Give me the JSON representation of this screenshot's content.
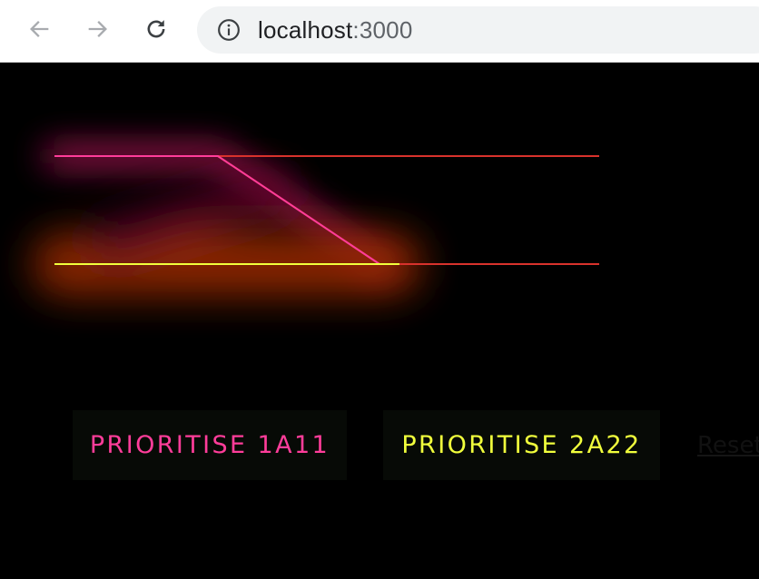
{
  "browser": {
    "url_host": "localhost",
    "url_port": ":3000",
    "icons": {
      "back": "arrow-left-icon",
      "forward": "arrow-right-icon",
      "reload": "reload-icon",
      "site_info": "info-circle-icon"
    }
  },
  "app": {
    "buttons": [
      {
        "label": "PRIORITISE 1A11",
        "color": "#ff3d9a"
      },
      {
        "label": "PRIORITISE 2A22",
        "color": "#f1ff3c"
      }
    ],
    "reset_label": "Reset",
    "colors": {
      "background": "#000000",
      "track_red": "#d8322c",
      "track_pink": "#ff3d9a",
      "track_yellow": "#f1ff3c",
      "button_bg": "#070a06"
    }
  }
}
